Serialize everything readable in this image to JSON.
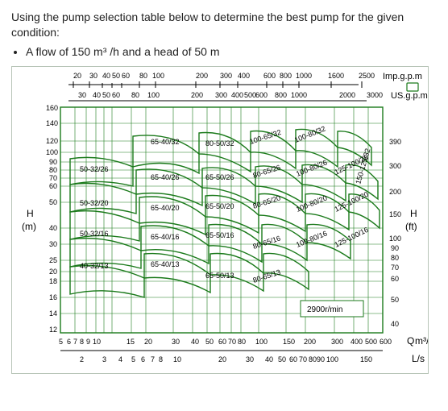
{
  "question": {
    "intro": "Using the pump selection table below to determine the best pump for the given condition:",
    "bullet": "A flow of 150 m³ /h and a head of 50 m"
  },
  "chart_data": {
    "type": "area",
    "title": "",
    "speed_label": "2900r/min",
    "left_axis": {
      "label_top": "H",
      "label_bottom": "(m)",
      "ticks": [
        12,
        14,
        16,
        18,
        20,
        25,
        30,
        40,
        50,
        60,
        70,
        80,
        90,
        100,
        120,
        140,
        160
      ]
    },
    "right_axis": {
      "label_top": "H",
      "label_bottom": "(ft)",
      "ticks": [
        40,
        50,
        60,
        70,
        80,
        90,
        100,
        150,
        200,
        300,
        390
      ]
    },
    "bottom_axis_1": {
      "label_left": "Q",
      "label_right": "m³/h",
      "ticks": [
        5,
        6,
        7,
        8,
        9,
        10,
        15,
        20,
        30,
        40,
        50,
        60,
        70,
        80,
        100,
        150,
        200,
        300,
        400,
        500,
        600
      ]
    },
    "bottom_axis_2": {
      "label": "L/s",
      "ticks": [
        2,
        3,
        4,
        5,
        6,
        7,
        8,
        10,
        20,
        30,
        40,
        50,
        60,
        70,
        80,
        90,
        100,
        150
      ]
    },
    "top_axis_1": {
      "label": "Imp.g.p.m",
      "ticks": [
        20,
        30,
        40,
        50,
        60,
        80,
        100,
        200,
        300,
        400,
        600,
        800,
        1000,
        1600,
        2500
      ]
    },
    "top_axis_2": {
      "label": "US.g.p.m",
      "ticks": [
        30,
        40,
        50,
        60,
        80,
        100,
        200,
        300,
        400,
        500,
        600,
        800,
        1000,
        2000,
        3000
      ]
    },
    "series": [
      {
        "name": "50-32/26"
      },
      {
        "name": "50-32/20"
      },
      {
        "name": "50-32/16"
      },
      {
        "name": "40-32/13"
      },
      {
        "name": "65-40/32"
      },
      {
        "name": "65-40/26"
      },
      {
        "name": "65-40/20"
      },
      {
        "name": "65-40/16"
      },
      {
        "name": "65-40/13"
      },
      {
        "name": "80-50/32"
      },
      {
        "name": "65-50/26"
      },
      {
        "name": "65-50/20"
      },
      {
        "name": "65-50/16"
      },
      {
        "name": "65-50/13"
      },
      {
        "name": "100-65/32"
      },
      {
        "name": "80-65/26"
      },
      {
        "name": "80-65/20"
      },
      {
        "name": "80-65/16"
      },
      {
        "name": "80-65/13"
      },
      {
        "name": "100-80/32"
      },
      {
        "name": "100-80/26"
      },
      {
        "name": "100-80/20"
      },
      {
        "name": "100-80/16"
      },
      {
        "name": "125-100/26"
      },
      {
        "name": "125-100/20"
      },
      {
        "name": "125-100/16"
      },
      {
        "name": "150-125/32"
      }
    ]
  }
}
